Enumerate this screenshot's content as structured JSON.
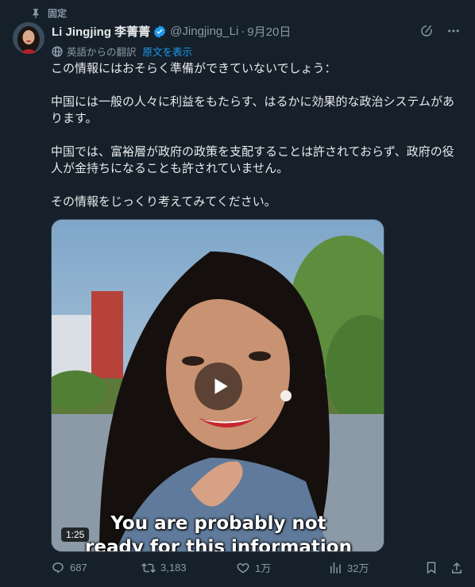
{
  "pinned": {
    "label": "固定"
  },
  "author": {
    "display_name": "Li Jingjing 李菁菁",
    "handle": "@Jingjing_Li",
    "date": "9月20日"
  },
  "translation": {
    "label": "英語からの翻訳",
    "show_original": "原文を表示"
  },
  "body": {
    "p1": "この情報にはおそらく準備ができていないでしょう：",
    "p2": "中国には一般の人々に利益をもたらす、はるかに効果的な政治システムがあります。",
    "p3": "中国では、富裕層が政府の政策を支配することは許されておらず、政府の役人が金持ちになることも許されていません。",
    "p4": "その情報をじっくり考えてみてください。"
  },
  "video": {
    "duration": "1:25",
    "caption_line1": "You are probably not",
    "caption_line2": "ready for this information"
  },
  "actions": {
    "replies": "687",
    "reposts": "3,183",
    "likes": "1万",
    "views": "32万"
  },
  "colors": {
    "background": "#15202b",
    "accent": "#1d9bf0",
    "secondary_text": "#8b98a5"
  }
}
